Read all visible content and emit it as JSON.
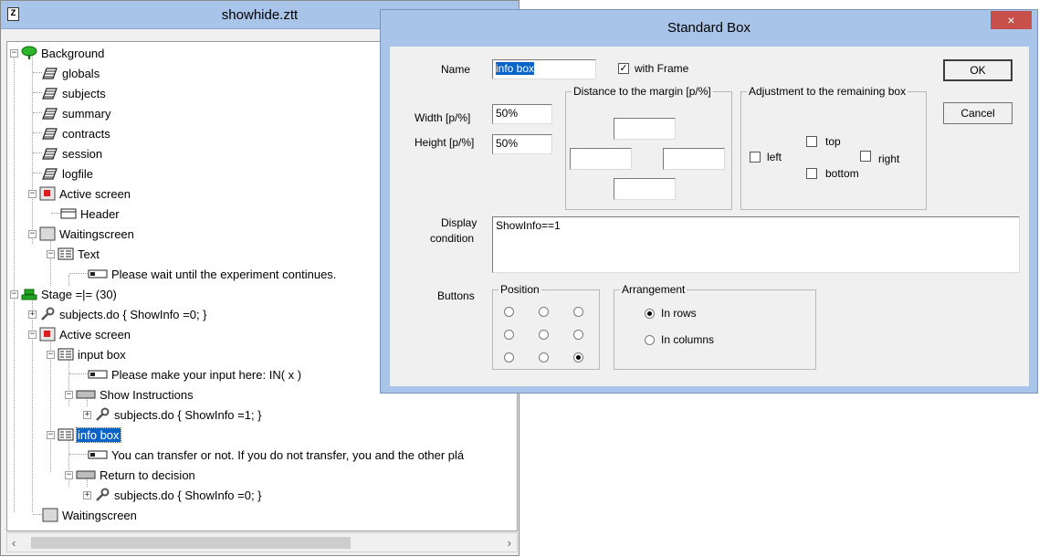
{
  "tree_window": {
    "title": "showhide.ztt",
    "nodes": [
      {
        "label": "Background",
        "icon": "globe-icon"
      },
      {
        "label": "globals",
        "icon": "table-icon"
      },
      {
        "label": "subjects",
        "icon": "table-icon"
      },
      {
        "label": "summary",
        "icon": "table-icon"
      },
      {
        "label": "contracts",
        "icon": "table-icon"
      },
      {
        "label": "session",
        "icon": "table-icon"
      },
      {
        "label": "logfile",
        "icon": "table-icon"
      },
      {
        "label": "Active screen",
        "icon": "active-screen-icon"
      },
      {
        "label": "Header",
        "icon": "header-box-icon"
      },
      {
        "label": "Waitingscreen",
        "icon": "waiting-screen-icon"
      },
      {
        "label": "Text",
        "icon": "standard-box-icon"
      },
      {
        "label": "Please wait until the experiment continues.",
        "icon": "item-icon"
      },
      {
        "label": "Stage =|= (30)",
        "icon": "stage-icon"
      },
      {
        "label": "subjects.do { ShowInfo =0; }",
        "icon": "program-wrench-icon"
      },
      {
        "label": "Active screen",
        "icon": "active-screen-icon"
      },
      {
        "label": "input box",
        "icon": "standard-box-icon"
      },
      {
        "label": "Please make your input here: IN( x )",
        "icon": "item-icon"
      },
      {
        "label": "Show Instructions",
        "icon": "button-icon"
      },
      {
        "label": "subjects.do { ShowInfo =1; }",
        "icon": "program-wrench-icon"
      },
      {
        "label": "info box",
        "icon": "standard-box-icon"
      },
      {
        "label": "You can transfer or not. If you do not transfer, you and the other plá",
        "icon": "item-icon"
      },
      {
        "label": "Return to decision",
        "icon": "button-icon"
      },
      {
        "label": "subjects.do { ShowInfo =0; }",
        "icon": "program-wrench-icon"
      },
      {
        "label": "Waitingscreen",
        "icon": "waiting-screen-icon"
      }
    ]
  },
  "dialog": {
    "title": "Standard Box",
    "close_glyph": "×",
    "name_label": "Name",
    "name_value": "info box",
    "with_frame_label": "with Frame",
    "with_frame_checked": true,
    "ok_label": "OK",
    "cancel_label": "Cancel",
    "width_label": "Width [p/%]",
    "width_value": "50%",
    "height_label": "Height [p/%]",
    "height_value": "50%",
    "margin_group": "Distance to the margin [p/%]",
    "margin_values": {
      "top": "",
      "left": "",
      "right": "",
      "bottom": ""
    },
    "adjust_group": "Adjustment to the remaining box",
    "adjust_left": "left",
    "adjust_top": "top",
    "adjust_right": "right",
    "adjust_bottom": "bottom",
    "display_label_1": "Display",
    "display_label_2": "condition",
    "display_value": "ShowInfo==1",
    "buttons_label": "Buttons",
    "position_group": "Position",
    "position_selected": "bottom-right",
    "arrangement_group": "Arrangement",
    "in_rows": "In rows",
    "in_columns": "In columns",
    "arrangement_selected": "In rows"
  },
  "colors": {
    "titlebar": "#a8c4e8",
    "selection": "#0a64c8",
    "close": "#c7504b"
  }
}
